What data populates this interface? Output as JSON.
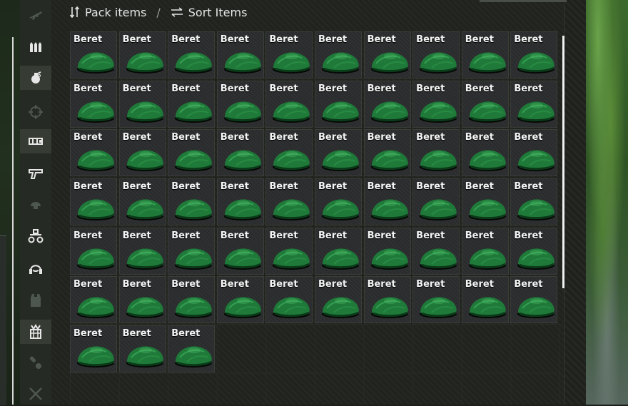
{
  "toolbar": {
    "pack_label": "Pack items",
    "separator": "/",
    "sort_label": "Sort Items"
  },
  "sidebar": {
    "categories": [
      {
        "icon": "rifle-icon",
        "state": "dim"
      },
      {
        "icon": "ammo-icon",
        "state": "normal"
      },
      {
        "icon": "grenade-icon",
        "state": "active"
      },
      {
        "icon": "scope-icon",
        "state": "dim"
      },
      {
        "icon": "magazine-icon",
        "state": "active"
      },
      {
        "icon": "pistol-icon",
        "state": "normal"
      },
      {
        "icon": "helmet-icon",
        "state": "dim"
      },
      {
        "icon": "night-vision-icon",
        "state": "normal"
      },
      {
        "icon": "headset-icon",
        "state": "normal"
      },
      {
        "icon": "vest-icon",
        "state": "dim"
      },
      {
        "icon": "backpack-icon",
        "state": "active"
      },
      {
        "icon": "medical-icon",
        "state": "dim"
      },
      {
        "icon": "tools-icon",
        "state": "dim"
      }
    ]
  },
  "inventory": {
    "item_name": "Beret",
    "item_icon": "beret-icon",
    "item_color": "#1f7a3a",
    "count": 63,
    "columns": 10
  }
}
